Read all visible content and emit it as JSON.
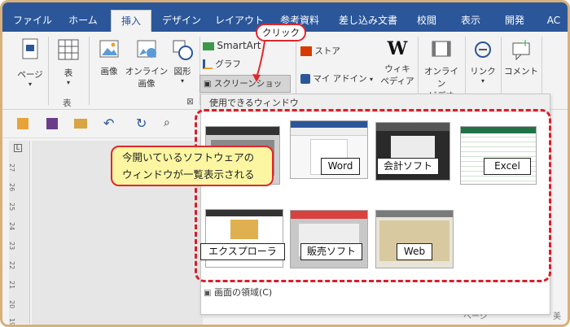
{
  "tabs": [
    "ファイル",
    "ホーム",
    "挿入",
    "デザイン",
    "レイアウト",
    "参考資料",
    "差し込み文書",
    "校閲",
    "表示",
    "開発",
    "AC"
  ],
  "ribbon": {
    "page": "ページ",
    "table": "表",
    "table_group": "表",
    "picture": "画像",
    "online_picture_1": "オンライン",
    "online_picture_2": "画像",
    "shapes": "図形",
    "smartart": "SmartArt",
    "chart": "グラフ",
    "screenshot": "スクリーンショット",
    "store": "ストア",
    "my_addins": "マイ アドイン",
    "wiki_1": "ウィキ",
    "wiki_2": "ペディア",
    "online_video_1": "オンライン",
    "online_video_2": "ビデオ",
    "link": "リンク",
    "comment": "コメント"
  },
  "panel": {
    "header": "使用できるウィンドウ",
    "footer": "画面の領域(C)",
    "windows": [
      {
        "label": ""
      },
      {
        "label": "Word"
      },
      {
        "label": "会計ソフト"
      },
      {
        "label": "Excel"
      },
      {
        "label": "エクスプローラ"
      },
      {
        "label": "販売ソフト"
      },
      {
        "label": "Web"
      }
    ]
  },
  "annotations": {
    "click": "クリック",
    "callout_line1": "今開いているソフトウェアの",
    "callout_line2": "ウィンドウが一覧表示される"
  },
  "ruler_numbers": [
    "27",
    "26",
    "25",
    "24",
    "23",
    "22",
    "21",
    "20",
    "19"
  ],
  "bottom_fragments": {
    "page": "ページ",
    "right": "美"
  },
  "colors": {
    "tabbar": "#2b579a",
    "accent_red": "#d91e2a",
    "callout_fill": "#fcf6a2",
    "frame": "#d9b07a"
  }
}
